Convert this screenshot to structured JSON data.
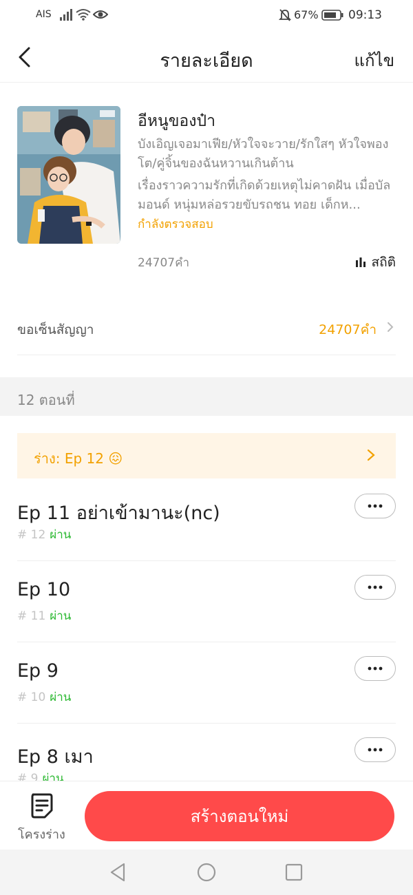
{
  "status_bar": {
    "carrier": "AIS",
    "battery_percent": "67%",
    "time": "09:13"
  },
  "header": {
    "title": "รายละเอียด",
    "edit_label": "แก้ไข"
  },
  "book": {
    "title": "อีหนูของป๋า",
    "tags": "บังเอิญเจอมาเฟีย/หัวใจจะวาย/รักใสๆ หัวใจพองโต/คู่จิ้นของฉันหวานเกินต้าน",
    "description": "เรื่องราวความรักที่เกิดด้วยเหตุไม่คาดฝัน เมื่อบัลมอนด์ หนุ่มหล่อรวยขับรถชน ทอย เด็กห...",
    "review_status": "กำลังตรวจสอบ",
    "word_count": "24707คำ",
    "stats_label": "สถิติ"
  },
  "contract": {
    "label": "ขอเซ็นสัญญา",
    "value": "24707คำ"
  },
  "chapters": {
    "count_label": "12 ตอนที่",
    "draft_banner": "ร่าง: Ep 12 😖",
    "episodes": [
      {
        "title": "Ep 11 อย่าเข้ามานะ(nc)",
        "number": "# 12",
        "state": "ผ่าน"
      },
      {
        "title": "Ep 10",
        "number": "# 11",
        "state": "ผ่าน"
      },
      {
        "title": "Ep 9",
        "number": "# 10",
        "state": "ผ่าน"
      },
      {
        "title": "Ep 8 เมา",
        "number": "# 9",
        "state": "ผ่าน"
      }
    ]
  },
  "bottom": {
    "draft_label": "โครงร่าง",
    "create_label": "สร้างตอนใหม่"
  },
  "colors": {
    "accent_orange": "#f2a100",
    "pass_green": "#2ab830",
    "primary_red": "#ff4a4a",
    "draft_banner_bg": "#fff5e6"
  }
}
